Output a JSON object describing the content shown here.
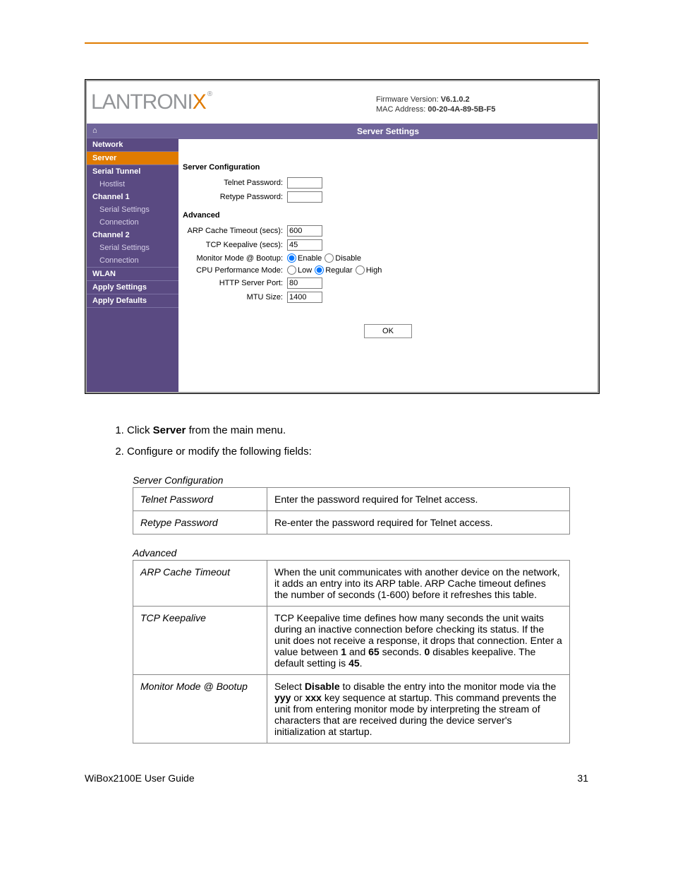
{
  "header": {
    "fw_label": "Firmware Version:",
    "fw_value": "V6.1.0.2",
    "mac_label": "MAC Address:",
    "mac_value": "00-20-4A-89-5B-F5",
    "title": "Server Settings"
  },
  "sidebar": {
    "home": "⌂",
    "network": "Network",
    "server": "Server",
    "serial_tunnel": "Serial Tunnel",
    "hostlist": "Hostlist",
    "channel1": "Channel 1",
    "serial_settings1": "Serial Settings",
    "connection1": "Connection",
    "channel2": "Channel 2",
    "serial_settings2": "Serial Settings",
    "connection2": "Connection",
    "wlan": "WLAN",
    "apply_settings": "Apply Settings",
    "apply_defaults": "Apply Defaults"
  },
  "form": {
    "config_header": "Server Configuration",
    "telnet_password_label": "Telnet Password:",
    "retype_password_label": "Retype Password:",
    "advanced_header": "Advanced",
    "arp_label": "ARP Cache Timeout (secs):",
    "arp_value": "600",
    "tcp_label": "TCP Keepalive (secs):",
    "tcp_value": "45",
    "monitor_label": "Monitor Mode @ Bootup:",
    "monitor_enable": "Enable",
    "monitor_disable": "Disable",
    "cpu_label": "CPU Performance Mode:",
    "cpu_low": "Low",
    "cpu_reg": "Regular",
    "cpu_high": "High",
    "http_label": "HTTP Server Port:",
    "http_value": "80",
    "mtu_label": "MTU Size:",
    "mtu_value": "1400",
    "ok": "OK"
  },
  "instructions": {
    "i1a": "Click",
    "i1b": "Server",
    "i1c": "from the main menu.",
    "i2": "Configure or modify the following fields:"
  },
  "table1": {
    "h": "Server Configuration",
    "r1k": "Telnet Password",
    "r1v": "Enter the password required for Telnet access.",
    "r2k": "Retype Password",
    "r2v": "Re-enter the password required for Telnet access."
  },
  "table2": {
    "h": "Advanced",
    "r1k": "ARP Cache Timeout",
    "r1v": "When the unit communicates with another device on the network, it adds an entry into its ARP table. ARP Cache timeout defines the number of seconds (1-600) before it refreshes this table.",
    "r2k": "TCP Keepalive",
    "r2v_a": "TCP Keepalive time defines how many seconds the unit waits during an inactive connection before checking its status. If the unit does not receive a response, it drops that connection. Enter a value between ",
    "r2v_b": "1",
    "r2v_c": " and ",
    "r2v_d": "65",
    "r2v_e": " seconds. ",
    "r2v_f": "0",
    "r2v_g": " disables keepalive. The default setting is ",
    "r2v_h": "45",
    "r2v_i": ".",
    "r3k": "Monitor Mode @ Bootup",
    "r3v_a": "Select ",
    "r3v_b": "Disable",
    "r3v_c": " to disable the entry into the monitor mode via the ",
    "r3v_d": "yyy",
    "r3v_e": " or ",
    "r3v_f": "xxx",
    "r3v_g": " key sequence at startup. This command prevents the unit from entering monitor mode by interpreting the stream of characters that are received during the device server's initialization at startup."
  },
  "footer": {
    "left": "WiBox2100E User Guide",
    "right": "31"
  }
}
